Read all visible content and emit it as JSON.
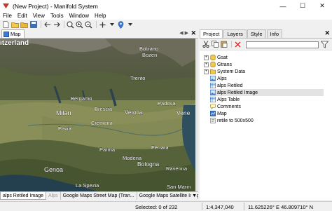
{
  "window": {
    "title": "(New Project) - Manifold System",
    "minimize_glyph": "—",
    "maximize_glyph": "☐",
    "close_glyph": "✕"
  },
  "menu": [
    "File",
    "Edit",
    "View",
    "Tools",
    "Window",
    "Help"
  ],
  "map_panel": {
    "tab_label": "Map",
    "arrows": "◀ ▶",
    "close_glyph": "✕"
  },
  "map_labels": [
    {
      "text": "itzerland",
      "cls": "country"
    },
    {
      "text": "Bolzano",
      "cls": "city"
    },
    {
      "text": "Bozen",
      "cls": "city"
    },
    {
      "text": "Trento",
      "cls": "city"
    },
    {
      "text": "Bergamo",
      "cls": "city"
    },
    {
      "text": "Brescia",
      "cls": "city"
    },
    {
      "text": "Padova",
      "cls": "city"
    },
    {
      "text": "Milan",
      "cls": "bigcity"
    },
    {
      "text": "Verona",
      "cls": "city"
    },
    {
      "text": "Vene",
      "cls": "bigcity"
    },
    {
      "text": "Pavia",
      "cls": "city"
    },
    {
      "text": "Cremona",
      "cls": "city"
    },
    {
      "text": "Parma",
      "cls": "city"
    },
    {
      "text": "Ferrara",
      "cls": "city"
    },
    {
      "text": "Modena",
      "cls": "city"
    },
    {
      "text": "Genoa",
      "cls": "bigcity"
    },
    {
      "text": "Bologna",
      "cls": "bigcity"
    },
    {
      "text": "Ravenna",
      "cls": "city"
    },
    {
      "text": "La Spezia",
      "cls": "city"
    },
    {
      "text": "San Marin",
      "cls": "city"
    }
  ],
  "map_bottom_tabs": [
    {
      "label": "alps Retiled Image",
      "state": "active"
    },
    {
      "label": "Alps",
      "state": "dim"
    },
    {
      "label": "Google Maps Street Map (Tran...",
      "state": "normal"
    },
    {
      "label": "Google Maps Satellite Image :...",
      "state": "normal"
    }
  ],
  "map_bottom_arrow": "▼",
  "right_panel": {
    "tabs": [
      {
        "label": "Project",
        "active": true
      },
      {
        "label": "Layers",
        "active": false
      },
      {
        "label": "Style",
        "active": false
      },
      {
        "label": "Info",
        "active": false
      }
    ],
    "close_glyph": "✕",
    "filter_value": ""
  },
  "tree": [
    {
      "label": "Gsat",
      "icon": "database",
      "expander": "+",
      "selected": false
    },
    {
      "label": "Gtrans",
      "icon": "database",
      "expander": "+",
      "selected": false
    },
    {
      "label": "System Data",
      "icon": "folder",
      "expander": "+",
      "selected": false
    },
    {
      "label": "Alps",
      "icon": "image",
      "expander": "",
      "selected": false
    },
    {
      "label": "alps Retiled",
      "icon": "table",
      "expander": "",
      "selected": false
    },
    {
      "label": "alps Retiled Image",
      "icon": "image",
      "expander": "",
      "selected": true
    },
    {
      "label": "Alps Table",
      "icon": "table",
      "expander": "",
      "selected": false
    },
    {
      "label": "Comments",
      "icon": "comments",
      "expander": "",
      "selected": false
    },
    {
      "label": "Map",
      "icon": "map",
      "expander": "",
      "selected": false
    },
    {
      "label": "retile to 500x500",
      "icon": "query",
      "expander": "",
      "selected": false
    }
  ],
  "status": {
    "selection": "Selected: 0 of 232",
    "scale": "1:4,347,040",
    "coords": "11.625226° E 46.809710° N"
  },
  "colors": {
    "accent_blue": "#3a7bd5",
    "folder_yellow": "#f2c94c",
    "selected_bg": "#e3e3e3"
  }
}
